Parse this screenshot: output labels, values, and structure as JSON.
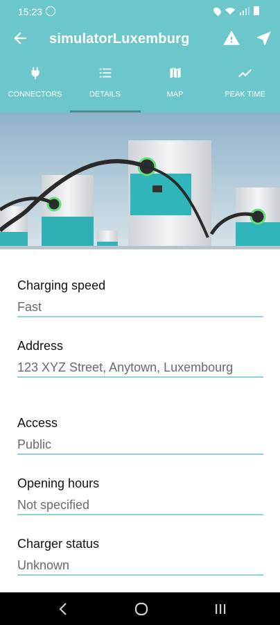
{
  "status_bar": {
    "time": "15:23",
    "icons": [
      "whatsapp-icon",
      "location-icon",
      "wifi-icon",
      "signal-icon",
      "battery-icon"
    ]
  },
  "app_bar": {
    "title": "simulatorLuxemburg",
    "back_icon": "arrow-left-icon",
    "warning_icon": "warning-icon",
    "navigate_icon": "navigation-arrow-icon"
  },
  "tabs": [
    {
      "label": "CONNECTORS",
      "icon": "plug-icon"
    },
    {
      "label": "DETAILS",
      "icon": "list-icon"
    },
    {
      "label": "MAP",
      "icon": "map-icon"
    },
    {
      "label": "PEAK TIME",
      "icon": "trend-line-icon"
    }
  ],
  "active_tab": "DETAILS",
  "hero_image": {
    "alt": "charging stations"
  },
  "details": [
    {
      "label": "Charging speed",
      "value": "Fast"
    },
    {
      "label": "Address",
      "value": "123 XYZ Street, Anytown, Luxembourg"
    },
    {
      "label": "Access",
      "value": "Public"
    },
    {
      "label": "Opening hours",
      "value": "Not specified"
    },
    {
      "label": "Charger status",
      "value": "Unknown"
    }
  ],
  "colors": {
    "primary": "#6bc7c9",
    "accent_line": "#8fd3d4",
    "tab_indicator": "#4b8f91",
    "text_label": "#111111",
    "text_value": "#6a6a6a"
  }
}
